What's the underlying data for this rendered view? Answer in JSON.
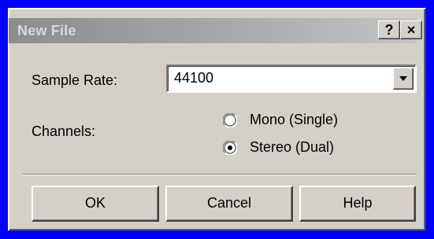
{
  "dialog": {
    "title": "New File",
    "help_caption": "?",
    "close_caption": "×"
  },
  "sample_rate": {
    "label": "Sample Rate:",
    "value": "44100"
  },
  "channels": {
    "label": "Channels:",
    "options": [
      {
        "label": "Mono (Single)",
        "selected": false
      },
      {
        "label": "Stereo (Dual)",
        "selected": true
      }
    ]
  },
  "buttons": {
    "ok": "OK",
    "cancel": "Cancel",
    "help": "Help"
  },
  "colors": {
    "desktop": "#0000fe",
    "face": "#d4d0c8",
    "titlebar_inactive": "#a9a9a9"
  },
  "icons": [
    "help-icon",
    "close-icon",
    "chevron-down-icon"
  ]
}
